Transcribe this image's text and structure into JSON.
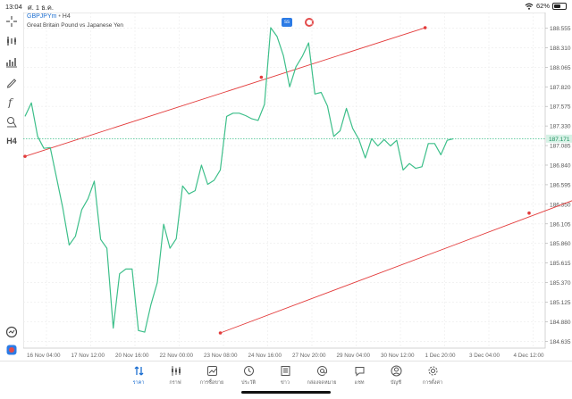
{
  "status_bar": {
    "time": "13:04",
    "date": "ศ. 1 ธ.ค.",
    "battery": "62%",
    "battery_level": 0.62
  },
  "chart_header": {
    "symbol": "GBPJPYm",
    "timeframe": "H4",
    "description": "Great Britain Pound vs Japanese Yen",
    "badge_a": "ss"
  },
  "left_tools": [
    {
      "name": "crosshair-icon"
    },
    {
      "name": "indicators-icon"
    },
    {
      "name": "volume-bars-icon"
    },
    {
      "name": "pencil-icon"
    },
    {
      "name": "function-icon"
    },
    {
      "name": "objects-icon"
    },
    {
      "name": "timeframe",
      "label": "H4"
    }
  ],
  "chart_data": {
    "type": "line",
    "price_levels": [
      "188.555",
      "188.310",
      "188.065",
      "187.820",
      "187.575",
      "187.330",
      "187.085",
      "186.840",
      "186.595",
      "186.350",
      "186.105",
      "185.860",
      "185.615",
      "185.370",
      "185.125",
      "184.880",
      "184.635"
    ],
    "current_price": "187.171",
    "time_labels": [
      "16 Nov 04:00",
      "17 Nov 12:00",
      "20 Nov 16:00",
      "22 Nov 00:00",
      "23 Nov 08:00",
      "24 Nov 16:00",
      "27 Nov 20:00",
      "29 Nov 04:00",
      "30 Nov 12:00",
      "1 Dec 20:00",
      "3 Dec 04:00",
      "4 Dec 12:00"
    ],
    "series_color": "#3dbf8a",
    "trendline_color": "#e33b3b",
    "ylim": [
      184.55,
      188.75
    ],
    "values": [
      187.45,
      187.62,
      187.2,
      187.05,
      187.06,
      186.68,
      186.3,
      185.84,
      185.95,
      186.28,
      186.42,
      186.64,
      185.91,
      185.8,
      184.8,
      185.48,
      185.54,
      185.54,
      184.77,
      184.75,
      185.1,
      185.37,
      186.1,
      185.8,
      185.92,
      186.58,
      186.48,
      186.52,
      186.84,
      186.6,
      186.65,
      186.78,
      187.45,
      187.49,
      187.49,
      187.46,
      187.42,
      187.4,
      187.6,
      188.56,
      188.45,
      188.21,
      187.82,
      188.07,
      188.2,
      188.37,
      187.73,
      187.75,
      187.58,
      187.2,
      187.27,
      187.55,
      187.3,
      187.16,
      186.93,
      187.17,
      187.08,
      187.16,
      187.08,
      187.15,
      186.78,
      186.86,
      186.8,
      186.82,
      187.11,
      187.11,
      186.97,
      187.15,
      187.17
    ],
    "upper_channel": [
      [
        0,
        186.95
      ],
      [
        37.5,
        187.94
      ],
      [
        63.5,
        188.56
      ]
    ],
    "lower_channel": [
      [
        31,
        184.74
      ],
      [
        80,
        186.24
      ],
      [
        115,
        187.23
      ]
    ]
  },
  "tabs": [
    {
      "label": "ราคา",
      "icon": "quotes-icon",
      "active": true
    },
    {
      "label": "กราฟ",
      "icon": "chart-icon"
    },
    {
      "label": "การซื้อขาย",
      "icon": "trade-icon"
    },
    {
      "label": "ประวัติ",
      "icon": "history-icon"
    },
    {
      "label": "ข่าว",
      "icon": "news-icon"
    },
    {
      "label": "กล่องจดหมาย",
      "icon": "mailbox-icon"
    },
    {
      "label": "แชท",
      "icon": "chat-icon"
    },
    {
      "label": "บัญชี",
      "icon": "account-icon"
    },
    {
      "label": "การตั้งค่า",
      "icon": "settings-icon"
    }
  ]
}
